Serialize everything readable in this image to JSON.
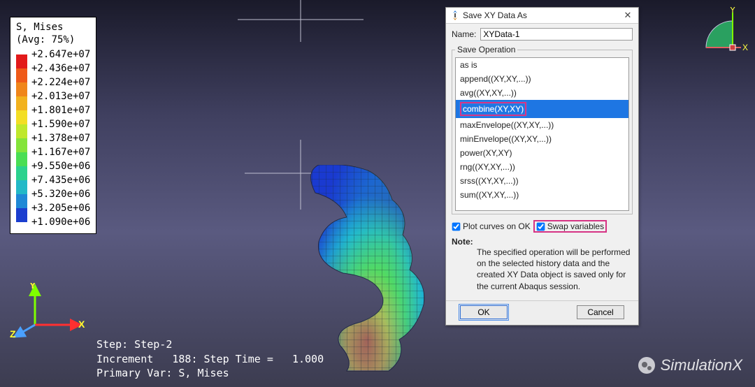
{
  "legend": {
    "title1": "S, Mises",
    "title2": "(Avg: 75%)",
    "values": [
      "+2.647e+07",
      "+2.436e+07",
      "+2.224e+07",
      "+2.013e+07",
      "+1.801e+07",
      "+1.590e+07",
      "+1.378e+07",
      "+1.167e+07",
      "+9.550e+06",
      "+7.435e+06",
      "+5.320e+06",
      "+3.205e+06",
      "+1.090e+06"
    ],
    "colors": [
      "#e21a1a",
      "#ef5a18",
      "#f0861a",
      "#f2b21e",
      "#f3de24",
      "#bfe82c",
      "#84e43a",
      "#4ade54",
      "#2cd28e",
      "#23b9c7",
      "#1f89d6",
      "#1b3ecf"
    ]
  },
  "compass": {
    "x_label": "X",
    "y_label": "Y"
  },
  "triad": {
    "x_label": "X",
    "y_label": "Y",
    "z_label": "Z"
  },
  "status": {
    "line1": "Step: Step-2",
    "line2": "Increment   188: Step Time =   1.000",
    "line3": "Primary Var: S, Mises"
  },
  "dialog": {
    "title": "Save XY Data As",
    "name_label": "Name:",
    "name_value": "XYData-1",
    "fieldset_label": "Save Operation",
    "items": [
      "as is",
      "append((XY,XY,...))",
      "avg((XY,XY,...))",
      "combine(XY,XY)",
      "maxEnvelope((XY,XY,...))",
      "minEnvelope((XY,XY,...))",
      "power(XY,XY)",
      "rng((XY,XY,...))",
      "srss((XY,XY,...))",
      "sum((XY,XY,...))"
    ],
    "selected_index": 3,
    "plot_label": "Plot curves on OK",
    "swap_label": "Swap variables",
    "plot_checked": true,
    "swap_checked": true,
    "note_label": "Note:",
    "note_body": "The specified operation will be performed on the selected history data and the created XY Data object is saved only for the current Abaqus session.",
    "ok_label": "OK",
    "cancel_label": "Cancel"
  },
  "watermark": {
    "text": "SimulationX"
  }
}
